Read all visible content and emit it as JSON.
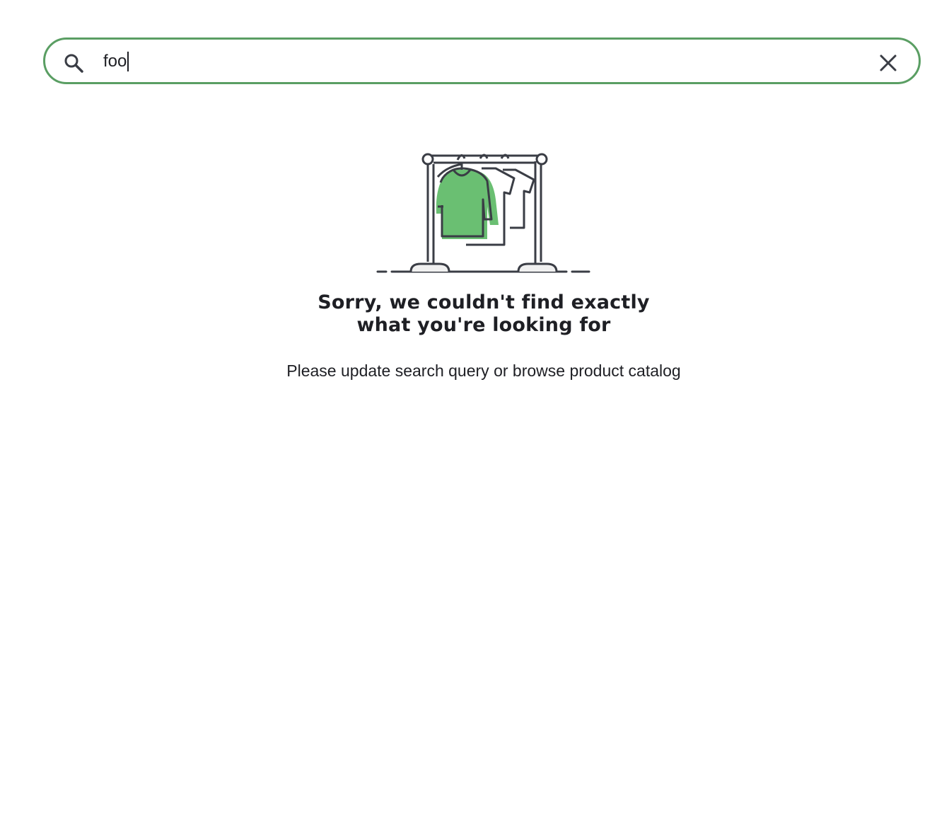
{
  "search": {
    "value": "foo",
    "border_color": "#5a9e63",
    "search_icon": "search-icon",
    "clear_icon": "close-icon"
  },
  "empty_state": {
    "illustration": "clothing-rack-icon",
    "accent_color": "#6abf72",
    "title": "Sorry, we couldn't find exactly what you're looking for",
    "subtitle": "Please update search query or browse product catalog"
  }
}
